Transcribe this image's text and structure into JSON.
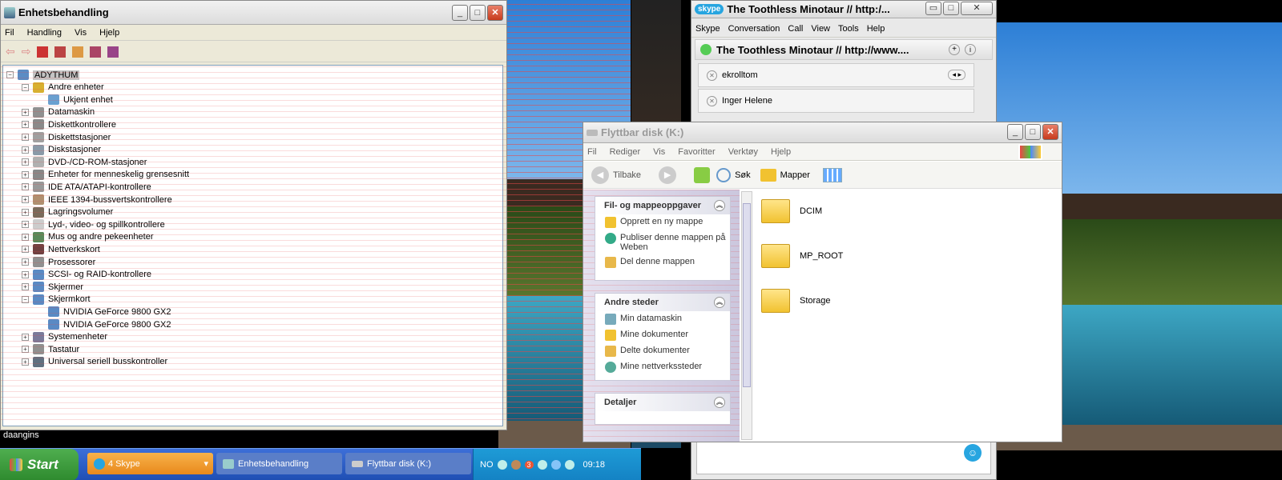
{
  "device_manager": {
    "title": "Enhetsbehandling",
    "menu": [
      "Fil",
      "Handling",
      "Vis",
      "Hjelp"
    ],
    "tree": [
      {
        "label": "ADYTHUM",
        "level": 0,
        "expander": "minus",
        "selected": true
      },
      {
        "label": "Andre enheter",
        "level": 1,
        "expander": "minus"
      },
      {
        "label": "Ukjent enhet",
        "level": 2,
        "expander": "none"
      },
      {
        "label": "Datamaskin",
        "level": 1,
        "expander": "plus"
      },
      {
        "label": "Diskettkontrollere",
        "level": 1,
        "expander": "plus"
      },
      {
        "label": "Diskettstasjoner",
        "level": 1,
        "expander": "plus"
      },
      {
        "label": "Diskstasjoner",
        "level": 1,
        "expander": "plus"
      },
      {
        "label": "DVD-/CD-ROM-stasjoner",
        "level": 1,
        "expander": "plus"
      },
      {
        "label": "Enheter for menneskelig grensesnitt",
        "level": 1,
        "expander": "plus"
      },
      {
        "label": "IDE ATA/ATAPI-kontrollere",
        "level": 1,
        "expander": "plus"
      },
      {
        "label": "IEEE 1394-bussvertskontrollere",
        "level": 1,
        "expander": "plus"
      },
      {
        "label": "Lagringsvolumer",
        "level": 1,
        "expander": "plus"
      },
      {
        "label": "Lyd-, video- og spillkontrollere",
        "level": 1,
        "expander": "plus"
      },
      {
        "label": "Mus og andre pekeenheter",
        "level": 1,
        "expander": "plus"
      },
      {
        "label": "Nettverkskort",
        "level": 1,
        "expander": "plus"
      },
      {
        "label": "Prosessorer",
        "level": 1,
        "expander": "plus"
      },
      {
        "label": "SCSI- og RAID-kontrollere",
        "level": 1,
        "expander": "plus"
      },
      {
        "label": "Skjermer",
        "level": 1,
        "expander": "plus"
      },
      {
        "label": "Skjermkort",
        "level": 1,
        "expander": "minus"
      },
      {
        "label": "NVIDIA GeForce 9800 GX2",
        "level": 2,
        "expander": "none"
      },
      {
        "label": "NVIDIA GeForce 9800 GX2",
        "level": 2,
        "expander": "none"
      },
      {
        "label": "Systemenheter",
        "level": 1,
        "expander": "plus"
      },
      {
        "label": "Tastatur",
        "level": 1,
        "expander": "plus"
      },
      {
        "label": "Universal seriell busskontroller",
        "level": 1,
        "expander": "plus"
      }
    ]
  },
  "skype": {
    "title": "The Toothless Minotaur // http:/...",
    "menu": [
      "Skype",
      "Conversation",
      "Call",
      "View",
      "Tools",
      "Help"
    ],
    "conversation_title": "The Toothless Minotaur // http://www....",
    "participants": [
      "ekrolltom",
      "Inger Helene"
    ]
  },
  "explorer": {
    "title": "Flyttbar disk (K:)",
    "menu": [
      "Fil",
      "Rediger",
      "Vis",
      "Favoritter",
      "Verktøy",
      "Hjelp"
    ],
    "toolbar": {
      "back": "Tilbake",
      "search": "Søk",
      "folders": "Mapper"
    },
    "panels": [
      {
        "title": "Fil- og mappeoppgaver",
        "items": [
          "Opprett en ny mappe",
          "Publiser denne mappen på Weben",
          "Del denne mappen"
        ]
      },
      {
        "title": "Andre steder",
        "items": [
          "Min datamaskin",
          "Mine dokumenter",
          "Delte dokumenter",
          "Mine nettverkssteder"
        ]
      },
      {
        "title": "Detaljer",
        "items": []
      }
    ],
    "folders": [
      "DCIM",
      "MP_ROOT",
      "Storage"
    ]
  },
  "taskbar": {
    "start_label": "Start",
    "buttons": [
      "4 Skype",
      "Enhetsbehandling",
      "Flyttbar disk (K:)"
    ],
    "tray_lang": "NO",
    "clock": "09:18",
    "tray_badge": "3"
  },
  "desktop_label": "daangins"
}
